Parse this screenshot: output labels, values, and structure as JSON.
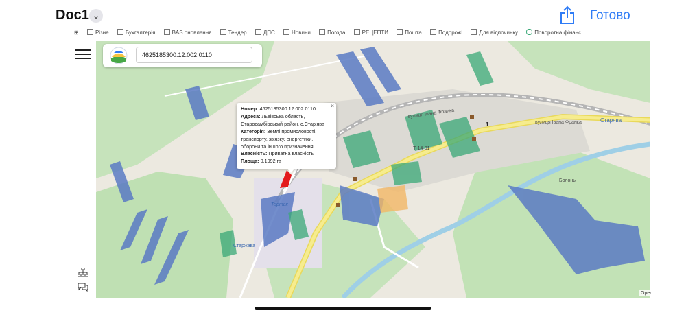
{
  "header": {
    "doc_title": "Doc1",
    "done_label": "Готово"
  },
  "bookmarks": [
    "Різне",
    "Бухгалтерія",
    "BAS оновлення",
    "Тендер",
    "ДПС",
    "Новини",
    "Погода",
    "РЕЦЕПТИ",
    "Пошта",
    "Подорожі",
    "Для відпочинку",
    "Поворотна фінанс..."
  ],
  "search": {
    "value": "4625185300:12:002:0110"
  },
  "popup": {
    "number_label": "Номер:",
    "number_value": "4625185300:12:002:0110",
    "address_label": "Адреса:",
    "address_value": "Львівська область, Старосамбірський район, с.Стар'ява",
    "category_label": "Категорія:",
    "category_value": "Землі промисловості, транспорту, зв'язку, енергетики, оборони та іншого призначення",
    "ownership_label": "Власність:",
    "ownership_value": "Приватна власність",
    "area_label": "Площа:",
    "area_value": "0.1992 га",
    "close": "×"
  },
  "map_labels": {
    "street_1": "вулиця Івана Франка",
    "street_2": "вулиця Івана Франка",
    "road_code": "Т-14-01",
    "place_starzhava": "Старжава",
    "place_tartak": "Тартак",
    "place_bolon": "Болонь",
    "place_starava": "Старява",
    "attribution": "Oper",
    "marker": "1"
  },
  "colors": {
    "accent": "#2f7cf6",
    "parcel_selected": "#e31a1c",
    "parcel_blue": "#5b7bc4",
    "parcel_teal": "#3aa877",
    "forest": "#b9dcb0",
    "river": "#a9d4e8",
    "road_yellow": "#f6e97a"
  },
  "icons": [
    "chevron-down-icon",
    "share-icon",
    "hamburger-menu-icon",
    "sitemap-icon",
    "chat-icon",
    "logo-icon",
    "close-icon"
  ]
}
